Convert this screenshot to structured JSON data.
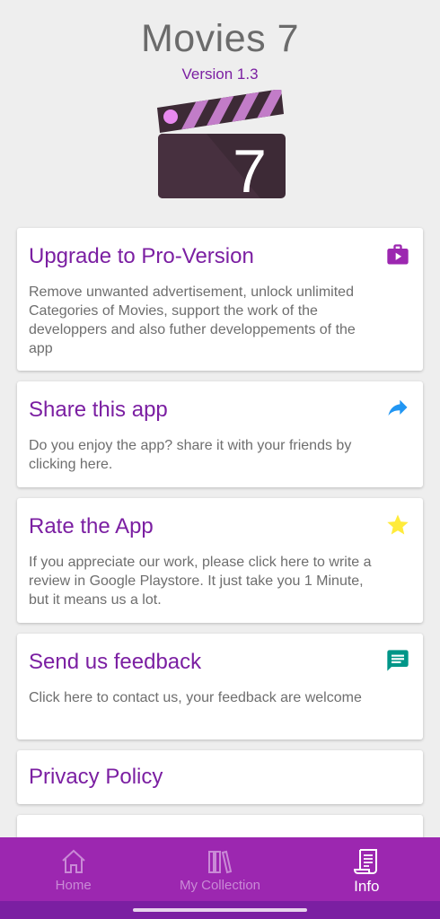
{
  "header": {
    "title": "Movies 7",
    "version": "Version 1.3",
    "logo_number": "7"
  },
  "cards": [
    {
      "title": "Upgrade to Pro-Version",
      "description": "Remove unwanted advertisement, unlock unlimited Categories of Movies, support the work of the developpers and also futher developpements of the app",
      "icon": "briefcase-play-icon",
      "icon_color": "#9c27b0"
    },
    {
      "title": "Share this app",
      "description": "Do you enjoy the app? share it with your friends by clicking here.",
      "icon": "share-arrow-icon",
      "icon_color": "#2196f3"
    },
    {
      "title": "Rate the App",
      "description": "If you appreciate our work, please click here to write a review in Google Playstore. It just take you 1 Minute, but it means us a lot.",
      "icon": "star-icon",
      "icon_color": "#ffeb3b"
    },
    {
      "title": "Send us feedback",
      "description": "Click here to contact us, your feedback are welcome",
      "icon": "chat-message-icon",
      "icon_color": "#009688"
    },
    {
      "title": "Privacy Policy"
    }
  ],
  "bottom_nav": {
    "items": [
      {
        "label": "Home",
        "icon": "home-icon",
        "active": false
      },
      {
        "label": "My Collection",
        "icon": "library-icon",
        "active": false
      },
      {
        "label": "Info",
        "icon": "info-document-icon",
        "active": true
      }
    ]
  },
  "colors": {
    "accent": "#7b1fa2",
    "nav_background": "#9c27b0",
    "system_bar": "#7b1fa2",
    "page_background": "#eeeeee"
  }
}
